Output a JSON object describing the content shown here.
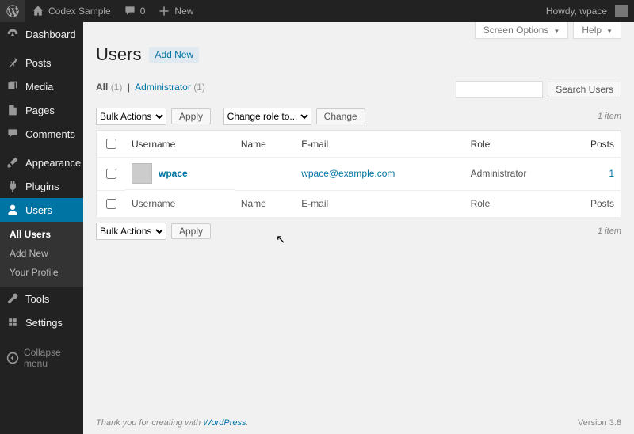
{
  "toolbar": {
    "site_name": "Codex Sample",
    "comments_count": "0",
    "new_label": "New",
    "howdy": "Howdy, wpace"
  },
  "sidebar": {
    "items": [
      {
        "id": "dashboard",
        "label": "Dashboard"
      },
      {
        "id": "posts",
        "label": "Posts"
      },
      {
        "id": "media",
        "label": "Media"
      },
      {
        "id": "pages",
        "label": "Pages"
      },
      {
        "id": "comments",
        "label": "Comments"
      },
      {
        "id": "appearance",
        "label": "Appearance"
      },
      {
        "id": "plugins",
        "label": "Plugins"
      },
      {
        "id": "users",
        "label": "Users"
      },
      {
        "id": "tools",
        "label": "Tools"
      },
      {
        "id": "settings",
        "label": "Settings"
      }
    ],
    "users_submenu": [
      {
        "label": "All Users",
        "current": true
      },
      {
        "label": "Add New"
      },
      {
        "label": "Your Profile"
      }
    ],
    "collapse": "Collapse menu"
  },
  "screen_links": {
    "screen_options": "Screen Options",
    "help": "Help"
  },
  "heading": {
    "title": "Users",
    "add_new": "Add New"
  },
  "filters": {
    "all_label": "All",
    "all_count": "(1)",
    "admin_label": "Administrator",
    "admin_count": "(1)"
  },
  "search": {
    "placeholder": "",
    "button": "Search Users"
  },
  "bulk": {
    "label": "Bulk Actions",
    "apply": "Apply"
  },
  "role_change": {
    "label": "Change role to...",
    "change": "Change"
  },
  "pagination": {
    "items": "1 item"
  },
  "table": {
    "cols": {
      "username": "Username",
      "name": "Name",
      "email": "E-mail",
      "role": "Role",
      "posts": "Posts"
    },
    "rows": [
      {
        "username": "wpace",
        "name": "",
        "email": "wpace@example.com",
        "role": "Administrator",
        "posts": "1"
      }
    ]
  },
  "footer": {
    "prefix": "Thank you for creating with ",
    "wp": "WordPress",
    "suffix": ".",
    "version": "Version 3.8"
  }
}
